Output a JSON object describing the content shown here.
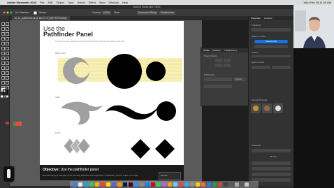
{
  "menubar": {
    "apple": "",
    "app": "Adobe Illustrator 2024",
    "items": [
      "File",
      "Edit",
      "Object",
      "Type",
      "Select",
      "Effect",
      "View",
      "Window",
      "Help"
    ],
    "clock": "Wed Feb 28 11:09 AM"
  },
  "window": {
    "title": "Adobe Illustrator 2024"
  },
  "controlbar": {
    "selection": "No Selection",
    "stroke_label": "Stroke:",
    "opacity_label": "Opacity:",
    "opacity_value": "100%",
    "style_label": "Style:",
    "uniform": "Document Setup",
    "preferences": "Preferences"
  },
  "document": {
    "tab": "ai_11_pathfinder.ai @ 66.67 % (CMYK/Preview)"
  },
  "artboard": {
    "title_line1": "Use the",
    "title_line2": "Pathfinder Panel",
    "subtitle": "Recreate the grey examples on the left using Pathfinder Panel and the shapes to the right.",
    "sections": [
      "Minus Front",
      "Unite",
      "Divide"
    ]
  },
  "objective": {
    "label": "Objective:",
    "text": "Use the pathfinder panel",
    "description": "Recreate the grey example on the left using Pathfinder Panel (Window > Pathfinder) and the shape to the right"
  },
  "pathfinder_panel": {
    "tabs": [
      "Stroke",
      "Gradient",
      "Transparency"
    ],
    "shape_modes": "Shape Modes:",
    "pathfinders": "Pathfinders:",
    "expand": "Expand"
  },
  "properties_panel": {
    "tabs": [
      "Properties",
      "Libraries"
    ],
    "transform": "Transform",
    "ruler": "Rulers & Grids",
    "snap": "Snap to Grid",
    "edit_artboard": "Edit Artboard",
    "guides": "Guides",
    "quick_actions": "Quick Actions",
    "doc_setup": "Document Setup",
    "preferences": "Preferences",
    "sample_prompts": "Sample Prompts",
    "new_artboard": "Artboards",
    "percent": "66.67%"
  },
  "hud": {
    "zoom": "66.67%"
  },
  "colors": {
    "accent": "#1473e6",
    "grey_shape": "#a0a0a0",
    "black_shape": "#000000",
    "highlight": "#f7efb5"
  }
}
